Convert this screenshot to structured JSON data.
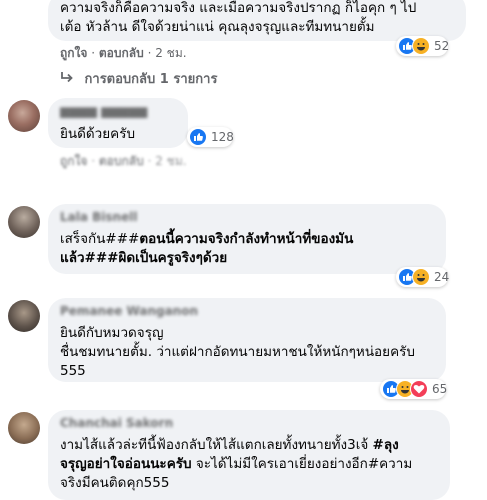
{
  "comments": [
    {
      "text_l1": "ความจริงก็คือความจริง และเมื่อความจริงปรากฏ ก็ไอคุก ๆ ไป",
      "text_l2": "เต้อ หัวล้าน ดีใจด้วยน่าแน่ คุณลุงจรุญและทีมทนายตั้ม",
      "like": "ถูกใจ",
      "reply": "ตอบกลับ",
      "time": "2 ชม.",
      "reactions": "52",
      "replies": "การตอบกลับ 1 รายการ"
    },
    {
      "text": "ยินดีด้วยครับ",
      "like": "ถูกใจ",
      "reply": "ตอบกลับ",
      "time": "2 ชม.",
      "reactions": "128"
    },
    {
      "author": "Lala Bisnell",
      "text_a": "เสร็จกัน###",
      "text_b": "ตอนนี้ความจริงกำลังทำหน้าที่ของมัน",
      "text_c": "แล้ว###",
      "text_d": "ผิดเป็นครูจริงๆด้วย",
      "reactions": "24"
    },
    {
      "author": "Pemanee Wanganon",
      "text_l1": "ยินดีกับหมวดจรุญ",
      "text_l2": "ชื่นชมทนายตั้ม. ว่าแต่ฝากอัดทนายมหาชนให้หนักๆหน่อยครับ",
      "text_l3": "555",
      "reactions": "65"
    },
    {
      "author": "Chanchai Sakorn",
      "text_a": "งามไส้แล้วล่ะทีนี้ฟ้องกลับให้ไส้แตกเลยทั้งทนายทั้ง3เจ้ ",
      "text_b": "#ลุง",
      "text_c": "จรุญอย่าใจอ่อนนะครับ",
      "text_d": " จะได้ไม่มีใครเอาเยี่ยงอย่างอีก#ความ",
      "text_e": "จริงมีคนติดคุก555"
    }
  ],
  "reaction_icons": {
    "like": "like-icon",
    "haha": "haha-icon",
    "love": "love-icon",
    "reply_arrow": "reply-arrow-icon"
  },
  "colors": {
    "bubble": "#f0f2f5",
    "like_blue": "#1877f2",
    "haha_yellow": "#f7b125",
    "love_red": "#f33e58",
    "meta_gray": "#65676b"
  }
}
